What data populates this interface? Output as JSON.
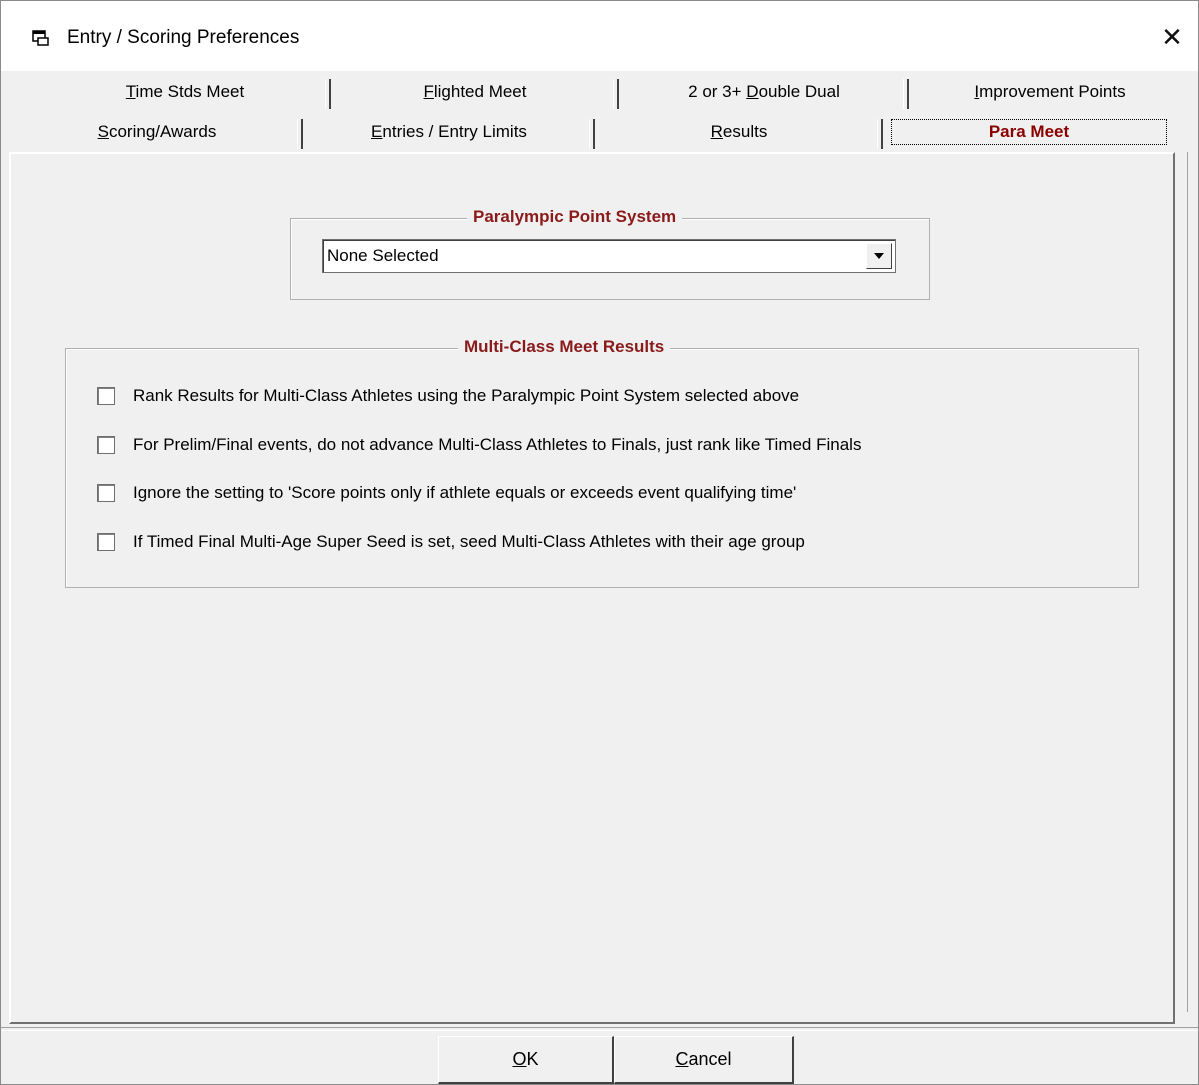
{
  "window": {
    "title": "Entry / Scoring Preferences",
    "close_glyph": "✕"
  },
  "tabs": {
    "row1": [
      {
        "label_pre": "",
        "mnemonic": "T",
        "label_post": "ime Stds Meet"
      },
      {
        "label_pre": "",
        "mnemonic": "F",
        "label_post": "lighted Meet"
      },
      {
        "label_pre": "2 or 3+ ",
        "mnemonic": "D",
        "label_post": "ouble Dual"
      },
      {
        "label_pre": "",
        "mnemonic": "I",
        "label_post": "mprovement Points"
      }
    ],
    "row2": [
      {
        "label_pre": "",
        "mnemonic": "S",
        "label_post": "coring/Awards"
      },
      {
        "label_pre": "",
        "mnemonic": "E",
        "label_post": "ntries / Entry Limits"
      },
      {
        "label_pre": "",
        "mnemonic": "R",
        "label_post": "esults"
      },
      {
        "label": "Para Meet",
        "active": true
      }
    ]
  },
  "para_point_system": {
    "legend": "Paralympic Point System",
    "selected": "None Selected"
  },
  "multi_class": {
    "legend": "Multi-Class Meet Results",
    "options": [
      {
        "label": "Rank Results for Multi-Class Athletes using the Paralympic Point System selected above",
        "checked": false
      },
      {
        "label": "For Prelim/Final events, do not advance Multi-Class Athletes to Finals, just rank like Timed Finals",
        "checked": false
      },
      {
        "label": "Ignore the setting to 'Score points only if athlete equals or exceeds event qualifying time'",
        "checked": false
      },
      {
        "label": "If Timed Final Multi-Age Super Seed is set, seed Multi-Class Athletes with their age group",
        "checked": false
      }
    ]
  },
  "buttons": {
    "ok": {
      "mnemonic": "O",
      "rest": "K"
    },
    "cancel": {
      "mnemonic": "C",
      "rest": "ancel"
    }
  }
}
